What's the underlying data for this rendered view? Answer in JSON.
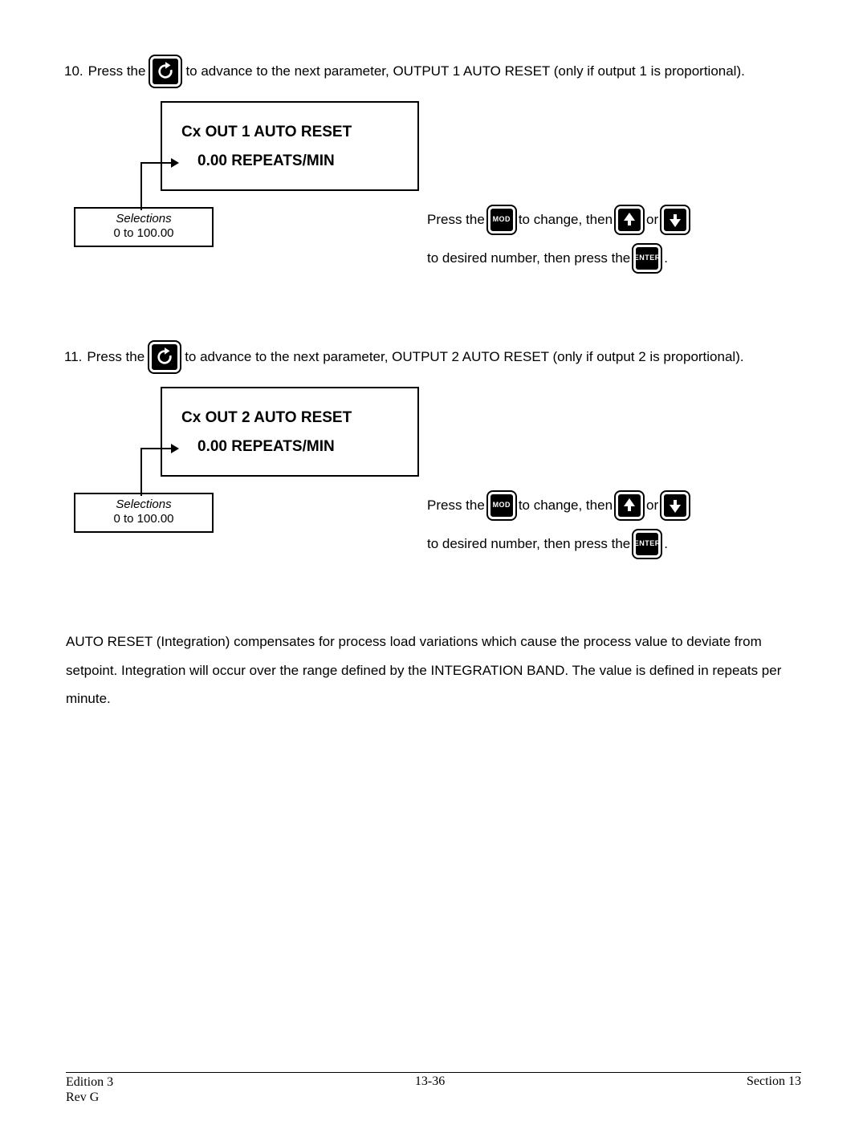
{
  "step10": {
    "num": "10.",
    "pre": "Press the",
    "post": " to advance to the next parameter, OUTPUT 1 AUTO RESET (only if output 1 is proportional)."
  },
  "disp1": {
    "line1": "Cx   OUT 1 AUTO RESET",
    "line2": "0.00 REPEATS/MIN"
  },
  "sel1": {
    "title": "Selections",
    "range": "0 to 100.00"
  },
  "actions": {
    "a1": "Press the",
    "a2": " to change, then ",
    "a3": " or ",
    "b1": "to desired  number, then press the ",
    "period": " ."
  },
  "keys": {
    "mod": "MOD",
    "enter": "ENTER"
  },
  "step11": {
    "num": "11.",
    "pre": "Press the",
    "post": " to advance to the next parameter, OUTPUT 2 AUTO RESET (only if output 2 is proportional)."
  },
  "disp2": {
    "line1": "Cx   OUT 2 AUTO RESET",
    "line2": "0.00 REPEATS/MIN"
  },
  "sel2": {
    "title": "Selections",
    "range": "0 to 100.00"
  },
  "para": "AUTO RESET (Integration) compensates for process load variations which cause the process value to deviate from setpoint.  Integration will occur over the range defined by the INTEGRATION BAND.  The value is defined in repeats per minute.",
  "footer": {
    "edition": "Edition 3",
    "rev": "Rev G",
    "page": "13-36",
    "section": "Section 13"
  }
}
